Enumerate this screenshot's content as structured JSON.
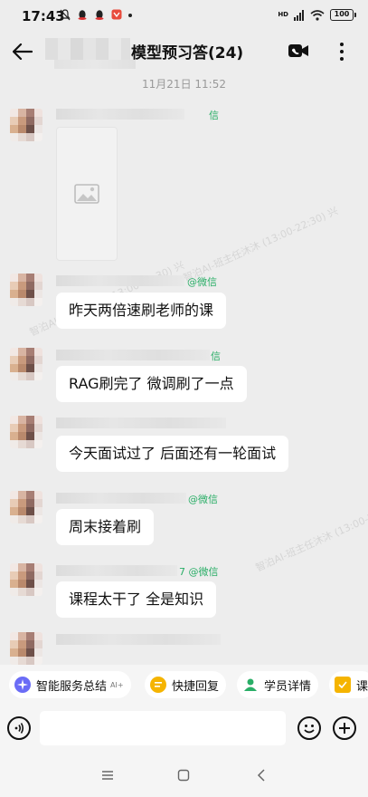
{
  "status_bar": {
    "time": "17:43",
    "network": "HD",
    "battery": "100"
  },
  "header": {
    "title": "模型预习答(24)",
    "back_icon": "arrow-left-icon",
    "video_icon": "video-call-icon",
    "more_icon": "more-vertical-icon"
  },
  "chat": {
    "timestamp": "11月21日  11:52",
    "messages": [
      {
        "nick_suffix": "信",
        "text": "",
        "type": "image"
      },
      {
        "nick_suffix": "@微信",
        "text": "昨天两倍速刷老师的课",
        "type": "text"
      },
      {
        "nick_suffix": "信",
        "text": "RAG刷完了 微调刷了一点",
        "type": "text"
      },
      {
        "nick_suffix": "",
        "text": "今天面试过了 后面还有一轮面试",
        "type": "text"
      },
      {
        "nick_suffix": "@微信",
        "text": "周末接着刷",
        "type": "text"
      },
      {
        "nick_suffix": "7 @微信",
        "text": "课程太干了 全是知识",
        "type": "text"
      },
      {
        "nick_suffix": "",
        "text": "",
        "type": "partial"
      }
    ],
    "watermark": "智泊AI-班主任沐沐 (13:00-22:30) 兴"
  },
  "quick_actions": [
    {
      "label": "智能服务总结",
      "badge": "AI+",
      "icon": "ai-sparkle-icon",
      "color": "#6a6cf6"
    },
    {
      "label": "快捷回复",
      "badge": "",
      "icon": "quick-reply-icon",
      "color": "#f5b400"
    },
    {
      "label": "学员详情",
      "badge": "",
      "icon": "student-icon",
      "color": "#2aae67"
    },
    {
      "label": "课",
      "badge": "",
      "icon": "course-icon",
      "color": "#f5b400"
    }
  ],
  "input": {
    "value": "",
    "placeholder": ""
  },
  "colors": {
    "background": "#ededed",
    "bubble": "#ffffff",
    "wechat_green": "#2aae67"
  }
}
